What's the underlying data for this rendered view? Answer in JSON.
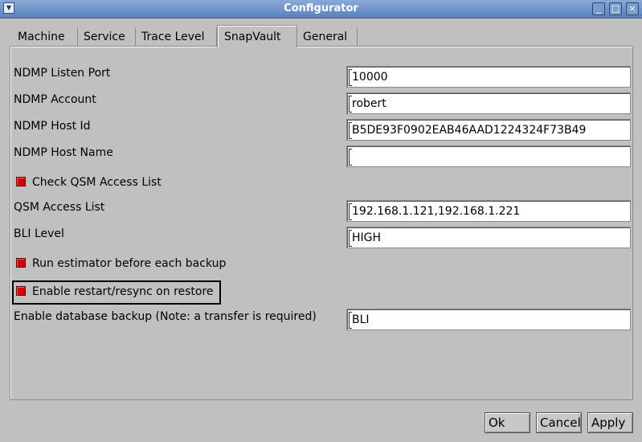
{
  "window": {
    "title": "Configurator"
  },
  "tabs": [
    "Machine",
    "Service",
    "Trace Level",
    "SnapVault",
    "General"
  ],
  "fields": {
    "ndmp_listen_port": {
      "label": "NDMP Listen Port",
      "value": "10000"
    },
    "ndmp_account": {
      "label": "NDMP Account",
      "value": "robert"
    },
    "ndmp_host_id": {
      "label": "NDMP Host Id",
      "value": "B5DE93F0902EAB46AAD1224324F73B49"
    },
    "ndmp_host_name": {
      "label": "NDMP Host Name",
      "value": ""
    },
    "qsm_access_list": {
      "label": "QSM Access List",
      "value": "192.168.1.121,192.168.1.221"
    },
    "bli_level": {
      "label": "BLI Level",
      "value": "HIGH"
    },
    "database_backup": {
      "label": "Enable database backup (Note: a transfer is required)",
      "value": "BLI"
    }
  },
  "checkboxes": {
    "check_qsm": {
      "label": "Check QSM Access List",
      "checked": true
    },
    "run_estimator": {
      "label": "Run estimator before each backup",
      "checked": true
    },
    "enable_restart": {
      "label": "Enable restart/resync on restore",
      "checked": true
    }
  },
  "buttons": {
    "ok": "Ok",
    "cancel": "Cancel",
    "apply": "Apply"
  },
  "colors": {
    "checkbox_checked": "#d10000",
    "titlebar": "#6d8fc8"
  }
}
